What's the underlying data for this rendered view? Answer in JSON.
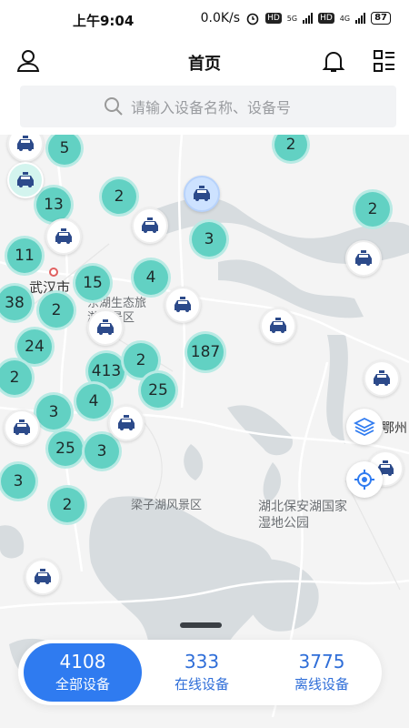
{
  "status_bar": {
    "time": "上午9:04",
    "speed": "0.0K/s",
    "hd1": "HD",
    "net1": "5G",
    "hd2": "HD",
    "net2": "4G",
    "battery": "87"
  },
  "header": {
    "title": "首页"
  },
  "search": {
    "placeholder": "请输入设备名称、设备号"
  },
  "map": {
    "clusters": [
      "5",
      "2",
      "13",
      "2",
      "2",
      "11",
      "3",
      "4",
      "15",
      "38",
      "2",
      "24",
      "187",
      "2",
      "413",
      "2",
      "25",
      "3",
      "4",
      "25",
      "3",
      "3",
      "2"
    ],
    "places": [
      "武汉市",
      "东湖生态旅游风景区",
      "梁子湖风景区",
      "湖北保安湖国家湿地公园",
      "鄂州"
    ]
  },
  "stats": [
    {
      "value": "4108",
      "label": "全部设备"
    },
    {
      "value": "333",
      "label": "在线设备"
    },
    {
      "value": "3775",
      "label": "离线设备"
    }
  ],
  "colors": {
    "cluster": "#62d1c3",
    "accent": "#2f7bf0",
    "water": "#d7dcdf"
  }
}
